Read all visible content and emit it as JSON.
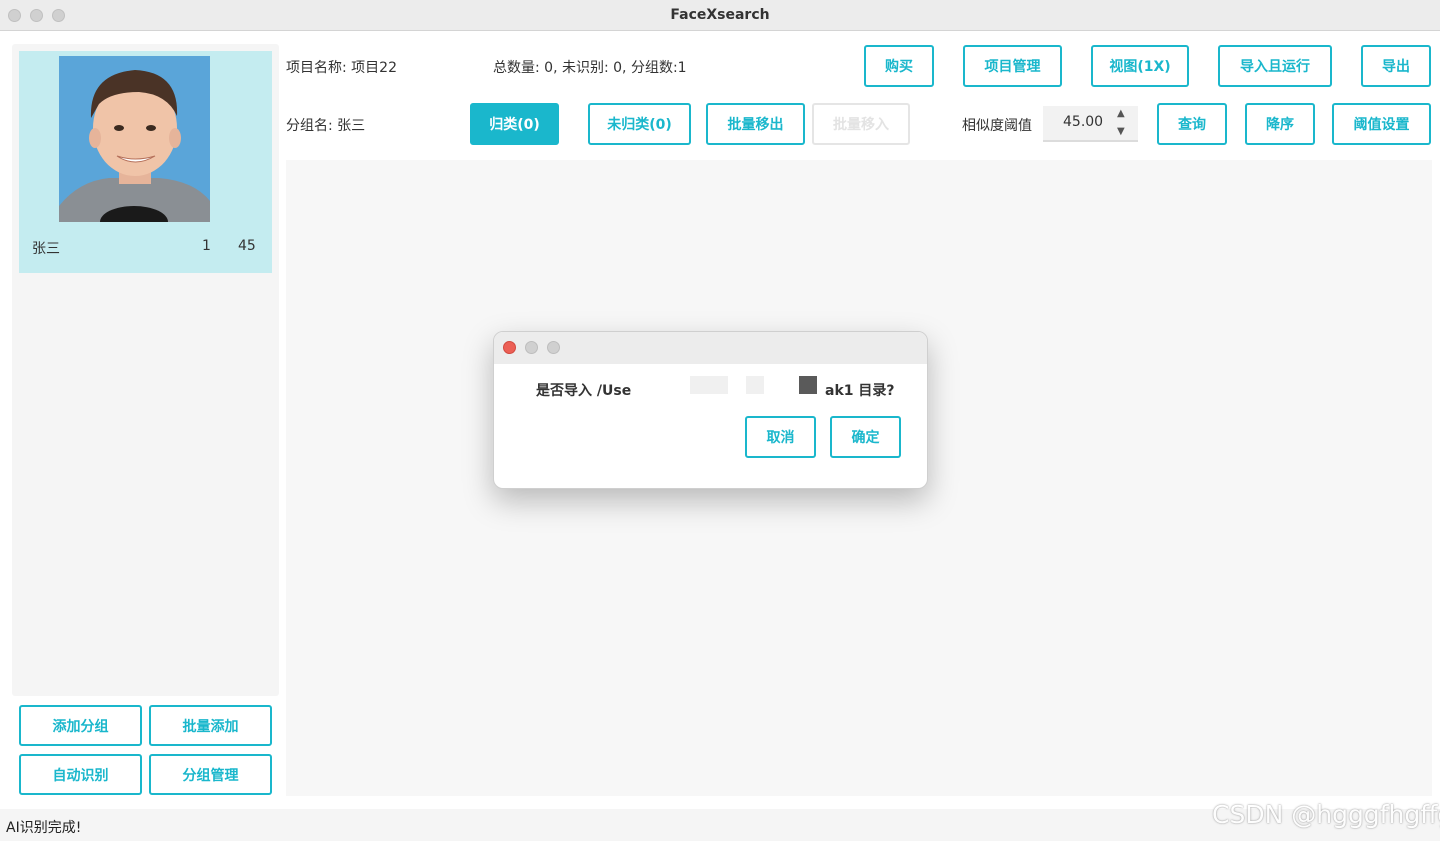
{
  "window": {
    "title": "FaceXsearch"
  },
  "sidebar": {
    "group_card": {
      "name": "张三",
      "count": "1",
      "score": "45"
    },
    "buttons": {
      "add_group": "添加分组",
      "batch_add": "批量添加",
      "auto_recognize": "自动识别",
      "group_manage": "分组管理"
    }
  },
  "header": {
    "project_label": "项目名称: 项目22",
    "stats": "总数量: 0, 未识别: 0, 分组数:1",
    "buttons": {
      "buy": "购买",
      "project_manage": "项目管理",
      "view": "视图(1X)",
      "import_run": "导入且运行",
      "export": "导出"
    }
  },
  "toolbar": {
    "group_label": "分组名: 张三",
    "tabs": {
      "classified": "归类(0)",
      "unclassified": "未归类(0)"
    },
    "buttons": {
      "batch_move_out": "批量移出",
      "batch_move_in": "批量移入",
      "query": "查询",
      "sort_desc": "降序",
      "threshold_settings": "阈值设置"
    },
    "similarity_label": "相似度阈值",
    "similarity_value": "45.00",
    "spin_up": "▲",
    "spin_down": "▼"
  },
  "dialog": {
    "message_prefix": "是否导入 /Use",
    "message_tail": "ak1 目录?",
    "cancel": "取消",
    "confirm": "确定"
  },
  "status": {
    "text": "AI识别完成!"
  },
  "watermark": "CSDN @hgggfhgffg",
  "colors": {
    "accent": "#1ab7cc",
    "card": "#c4ecf0",
    "close_red": "#ec5f55"
  }
}
